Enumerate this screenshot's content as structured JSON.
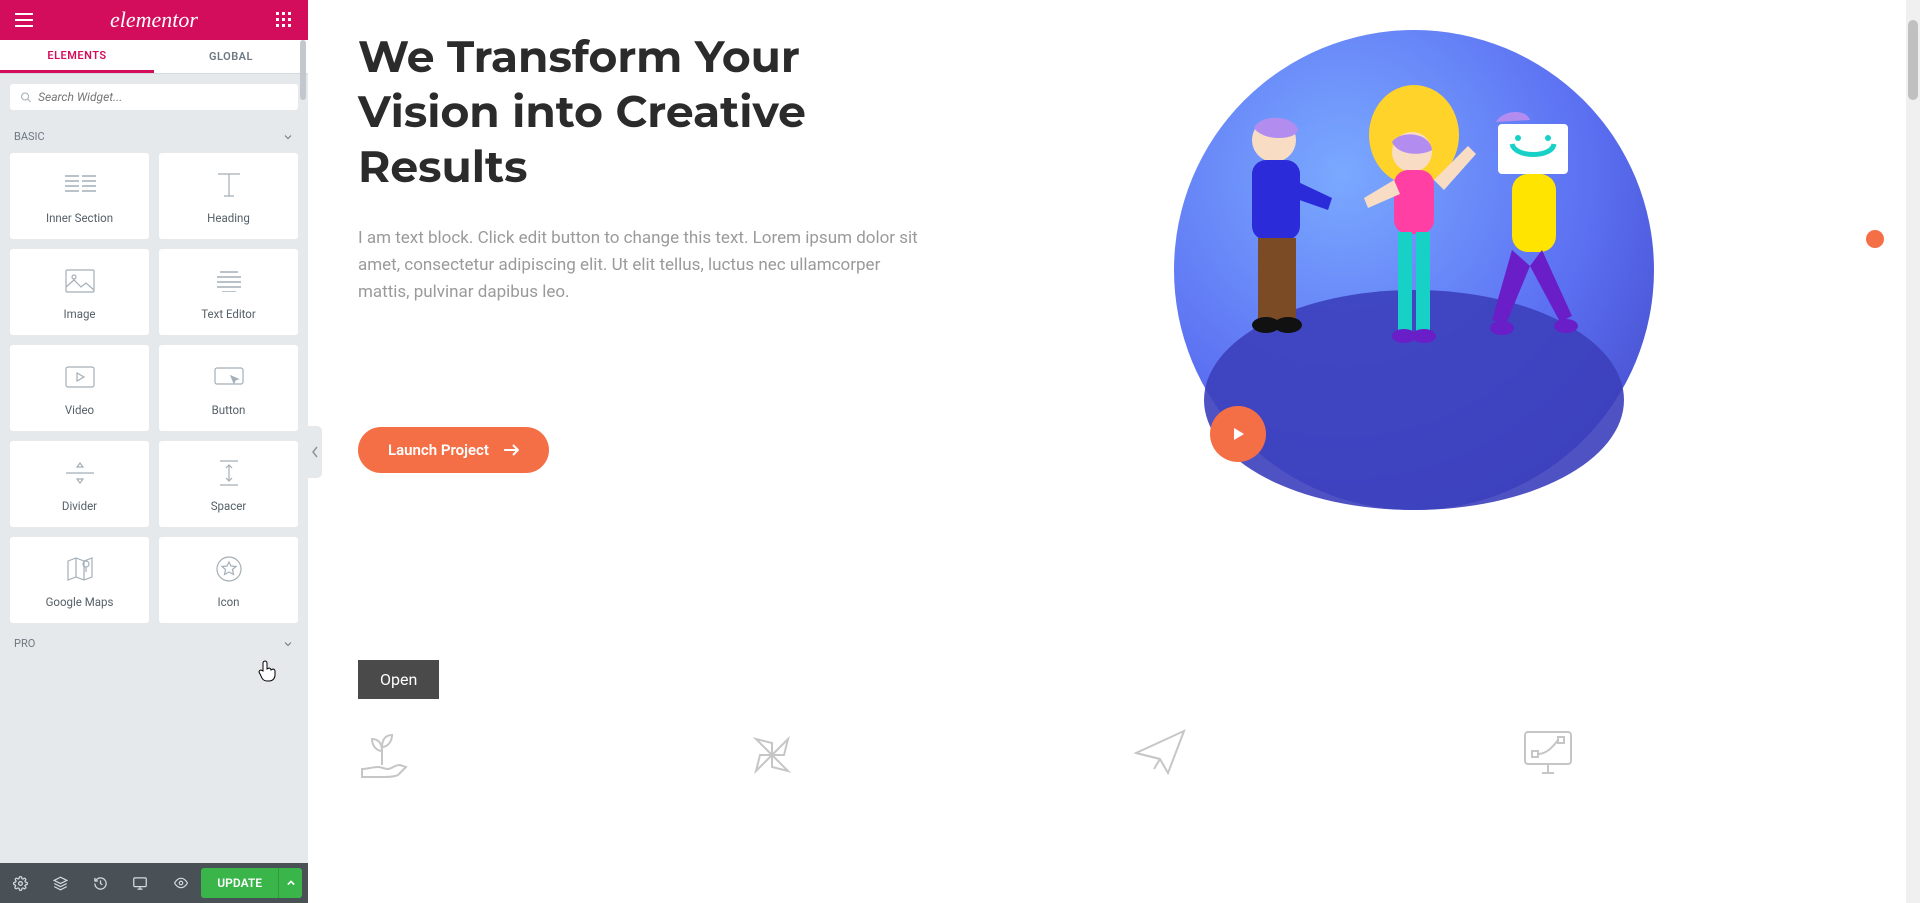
{
  "panel": {
    "logo": "elementor",
    "tabs": {
      "elements": "ELEMENTS",
      "global": "GLOBAL"
    },
    "search_placeholder": "Search Widget...",
    "cat_basic": "BASIC",
    "cat_pro": "PRO",
    "widgets": [
      {
        "id": "inner-section",
        "label": "Inner Section"
      },
      {
        "id": "heading",
        "label": "Heading"
      },
      {
        "id": "image",
        "label": "Image"
      },
      {
        "id": "text-editor",
        "label": "Text Editor"
      },
      {
        "id": "video",
        "label": "Video"
      },
      {
        "id": "button",
        "label": "Button"
      },
      {
        "id": "divider",
        "label": "Divider"
      },
      {
        "id": "spacer",
        "label": "Spacer"
      },
      {
        "id": "google-maps",
        "label": "Google Maps"
      },
      {
        "id": "icon",
        "label": "Icon"
      }
    ],
    "update": "UPDATE"
  },
  "page": {
    "hero_title": "We Transform Your Vision into Creative Results",
    "hero_body": "I am text block. Click edit button to change this text. Lorem ipsum dolor sit amet, consectetur adipiscing elit. Ut elit tellus, luctus nec ullamcorper mattis, pulvinar dapibus leo.",
    "cta_label": "Launch Project",
    "open_label": "Open"
  },
  "colors": {
    "brand": "#d30c5c",
    "cta": "#f56f46",
    "update": "#39b54a"
  }
}
